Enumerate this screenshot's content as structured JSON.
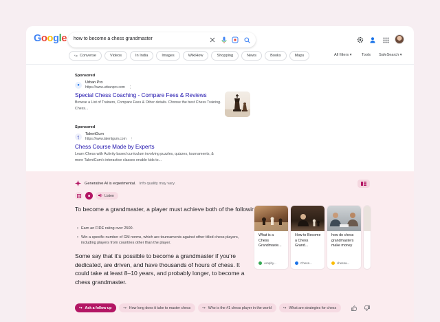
{
  "header": {
    "logo_letters": [
      "G",
      "o",
      "o",
      "g",
      "l",
      "e"
    ],
    "search_query": "how to become a chess grandmaster",
    "icons": [
      "clear-icon",
      "microphone-icon",
      "lens-icon",
      "search-icon",
      "settings-icon",
      "labs-icon",
      "apps-icon",
      "avatar"
    ]
  },
  "filters": {
    "chips": [
      "Converse",
      "Videos",
      "In India",
      "Images",
      "WikiHow",
      "Shopping",
      "News",
      "Books",
      "Maps"
    ],
    "all_filters": "All filters",
    "tools": "Tools",
    "safesearch": "SafeSearch"
  },
  "ads": [
    {
      "label": "Sponsored",
      "advertiser": "Urban Pro",
      "url": "https://www.urbanpro.com",
      "title": "Special Chess Coaching - Compare Fees & Reviews",
      "description": "Browse a List of Trainers, Compare Fees & Other details. Choose the best Chess Training. Chess..."
    },
    {
      "label": "Sponsored",
      "advertiser": "TalentGum",
      "url": "https://www.talentgum.com",
      "title": "Chess Course Made by Experts",
      "description": "Learn Chess with Activity based curriculum involving puzzles, quizzes, tournaments, & more TalentGum's interactive classes enable kids to..."
    }
  ],
  "ai": {
    "label": "Generative AI is experimental.",
    "label_muted": "Info quality may vary.",
    "listen": "Listen",
    "lead": "To become a grandmaster, a player must achieve both of the following:",
    "bullets": [
      "Earn an FIDE rating over 2500.",
      "Win a specific number of GM norms, which are tournaments against other titled chess players, including players from countries other than the player."
    ],
    "paragraph": "Some say that it's possible to become a grandmaster if you're dedicated, are driven, and have thousands of hours of chess. It could take at least 8–10 years, and probably longer, to become a chess grandmaster.",
    "cards": [
      {
        "title": "What is a Chess Grandmaste...",
        "source": "Amphy..."
      },
      {
        "title": "How to Become a Chess Grand...",
        "source": "Chess..."
      },
      {
        "title": "how do chess grandmasters make money",
        "source": "chessa..."
      }
    ],
    "followups": {
      "primary": "Ask a follow up",
      "items": [
        "How long does it take to master chess",
        "Who is the #1 chess player in the world",
        "What are strategies for chess"
      ]
    }
  },
  "colors": {
    "link_blue": "#1a0dab",
    "ai_background": "#fbecef",
    "ai_accent": "#b31664"
  }
}
